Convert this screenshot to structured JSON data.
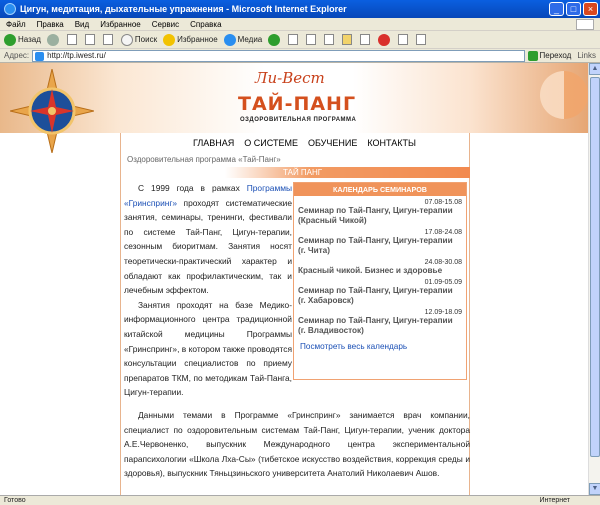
{
  "window": {
    "title": "Цигун, медитация, дыхательные упражнения - Microsoft Internet Explorer",
    "buttons": [
      "_",
      "□",
      "×"
    ]
  },
  "menu": [
    "Файл",
    "Правка",
    "Вид",
    "Избранное",
    "Сервис",
    "Справка"
  ],
  "toolbar": {
    "back": "Назад",
    "search": "Поиск",
    "favorites": "Избранное",
    "media": "Медиа"
  },
  "address": {
    "label": "Адрес:",
    "url": "http://tp.iwest.ru/",
    "go": "Переход",
    "links": "Links"
  },
  "header": {
    "script_logo": "Ли-Вест",
    "brand": "ТАЙ-ПАНГ",
    "subtitle": "ОЗДОРОВИТЕЛЬНАЯ ПРОГРАММА"
  },
  "nav": [
    "ГЛАВНАЯ",
    "О СИСТЕМЕ",
    "ОБУЧЕНИЕ",
    "КОНТАКТЫ"
  ],
  "breadcrumb": "Оздоровительная программа «Тай-Панг»",
  "section_title": "ТАЙ ПАНГ",
  "main": {
    "p1_start": "С 1999 года в рамках ",
    "p1_link": "Программы «Гринспринг»",
    "p1_rest": " проходят систематические занятия, семинары, тренинги, фестивали по системе Тай-Панг, Цигун-терапии, сезонным биоритмам. Занятия носят теоретически-практический характер и обладают как профилактическим, так и лечебным эффектом.",
    "p2": "Занятия проходят на базе Медико-информационного центра традиционной китайской медицины Программы «Гринспринг», в котором также проводятся консультации специалистов по приему препаратов ТКМ, по методикам Тай-Панга, Цигун-терапии.",
    "p3": "Данными темами в Программе «Гринспринг» занимается врач компании, специалист по оздоровительным системам Тай-Панг, Цигун-терапии, ученик доктора А.Е.Червоненко, выпускник Международного центра экспериментальной парапсихологии «Школа Лха-Сы» (тибетское искусство воздействия, коррекция среды и здоровья), выпускник Тяньцзиньского университета Анатолий Николаевич Ашов."
  },
  "calendar": {
    "title": "КАЛЕНДАРЬ СЕМИНАРОВ",
    "items": [
      {
        "date": "07.08-15.08",
        "title": "Семинар по Тай-Пангу, Цигун-терапии (Красный Чикой)"
      },
      {
        "date": "17.08-24.08",
        "title": "Семинар по Тай-Пангу, Цигун-терапии (г. Чита)"
      },
      {
        "date": "24.08-30.08",
        "title": "Красный чикой. Бизнес и здоровье"
      },
      {
        "date": "01.09-05.09",
        "title": "Семинар по Тай-Пангу, Цигун-терапии (г. Хабаровск)"
      },
      {
        "date": "12.09-18.09",
        "title": "Семинар по Тай-Пангу, Цигун-терапии (г. Владивосток)"
      }
    ],
    "link": "Посмотреть весь календарь"
  },
  "status": {
    "left": "Готово",
    "right": "Интернет"
  }
}
